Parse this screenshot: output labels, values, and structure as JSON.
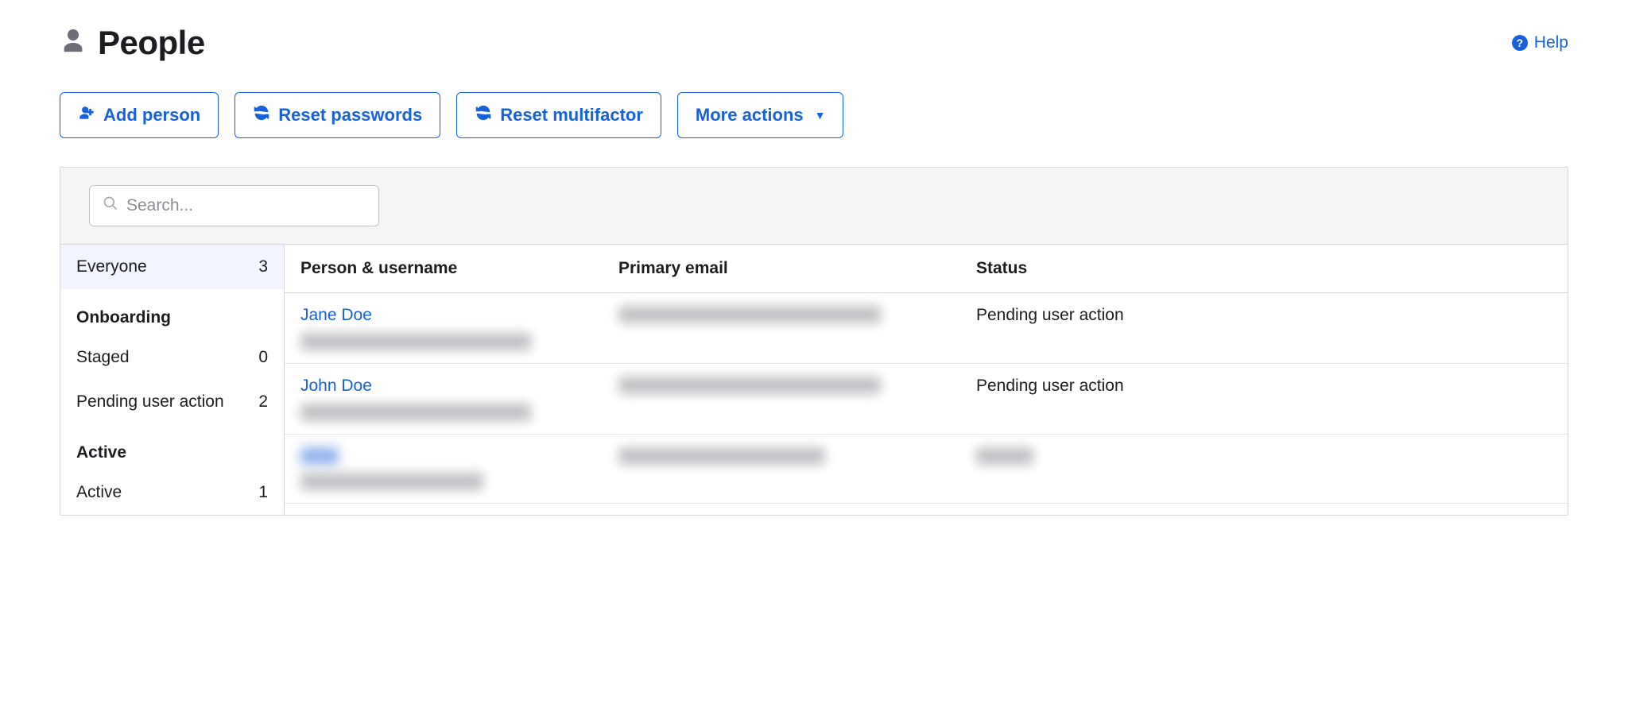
{
  "header": {
    "title": "People",
    "help_label": "Help"
  },
  "toolbar": {
    "add_person": "Add person",
    "reset_passwords": "Reset passwords",
    "reset_mfa": "Reset multifactor",
    "more_actions": "More actions"
  },
  "search": {
    "placeholder": "Search..."
  },
  "sidebar": {
    "everyone": {
      "label": "Everyone",
      "count": "3"
    },
    "heading_onboarding": "Onboarding",
    "staged": {
      "label": "Staged",
      "count": "0"
    },
    "pending": {
      "label": "Pending user action",
      "count": "2"
    },
    "heading_active": "Active",
    "active": {
      "label": "Active",
      "count": "1"
    }
  },
  "table": {
    "col_person": "Person & username",
    "col_email": "Primary email",
    "col_status": "Status",
    "rows": [
      {
        "name": "Jane Doe",
        "status": "Pending user action"
      },
      {
        "name": "John Doe",
        "status": "Pending user action"
      }
    ]
  }
}
